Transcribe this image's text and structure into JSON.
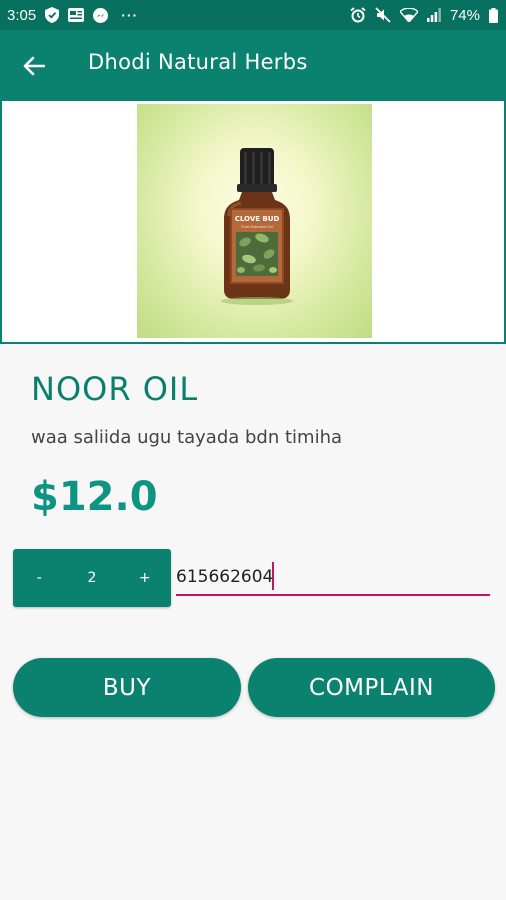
{
  "status_bar": {
    "time": "3:05",
    "battery": "74%",
    "left_icons": [
      "shield-icon",
      "news-icon",
      "messenger-icon",
      "more-dots-icon"
    ],
    "right_icons": [
      "alarm-icon",
      "mute-icon",
      "wifi-icon",
      "signal-icon",
      "battery-icon"
    ],
    "dots": "···"
  },
  "app_bar": {
    "title": "Dhodi Natural Herbs",
    "back_icon": "arrow-left-icon"
  },
  "product": {
    "name": "NOOR OIL",
    "description": "waa saliida ugu tayada bdn timiha",
    "price": "$12.0",
    "image_label_top": "CLOVE BUD",
    "image_label_sub": "Pure Essential Oil"
  },
  "quantity": {
    "minus": "-",
    "value": "2",
    "plus": "+"
  },
  "phone_input": {
    "value": "615662604"
  },
  "actions": {
    "buy": "BUY",
    "complain": "COMPLAIN"
  },
  "colors": {
    "primary": "#0b8270",
    "status_bar": "#07705f",
    "accent": "#c2185b",
    "price": "#0e9482"
  }
}
